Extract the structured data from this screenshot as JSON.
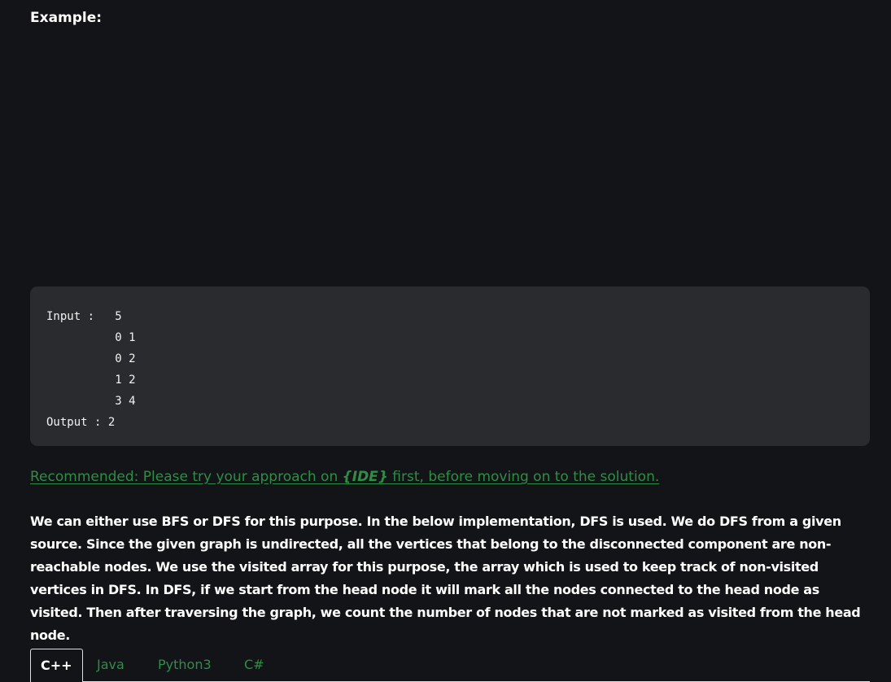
{
  "heading": "Example:",
  "code_block": {
    "text": "Input :   5\n          0 1\n          0 2\n          1 2\n          3 4\nOutput : 2"
  },
  "recommended": {
    "prefix": "Recommended: Please try your approach on ",
    "ide": "{IDE}",
    "suffix": " first, before moving on to the solution."
  },
  "paragraph": "We can either use BFS or DFS for this purpose. In the below implementation, DFS is used. We do DFS from a given source. Since the given graph is undirected, all the vertices that belong to the disconnected component are non-reachable nodes. We use the visited array for this purpose, the array which is used to keep track of non-visited vertices in DFS. In DFS, if we start from the head node it will mark all the nodes connected to the head node as visited. Then after traversing the graph, we count the number of nodes that are not marked as visited from the head node.",
  "tabs": [
    {
      "label": "C++",
      "active": true
    },
    {
      "label": "Java",
      "active": false
    },
    {
      "label": "Python3",
      "active": false
    },
    {
      "label": "C#",
      "active": false
    }
  ],
  "colors": {
    "background": "#131417",
    "code_background": "#2a2b2e",
    "link_green": "#2f8d46"
  }
}
